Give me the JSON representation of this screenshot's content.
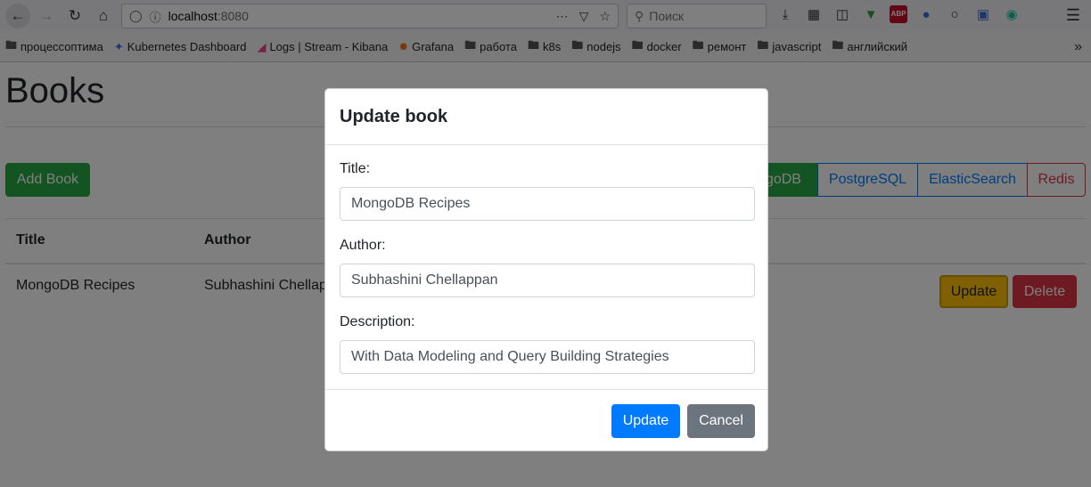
{
  "browser": {
    "url_host": "localhost",
    "url_port": ":8080",
    "search_placeholder": "Поиск",
    "bookmarks": [
      {
        "label": "процессоптима",
        "icon": "folder-icon"
      },
      {
        "label": "Kubernetes Dashboard",
        "icon": "kubernetes-icon"
      },
      {
        "label": "Logs | Stream - Kibana",
        "icon": "kibana-icon"
      },
      {
        "label": "Grafana",
        "icon": "grafana-icon"
      },
      {
        "label": "работа",
        "icon": "folder-icon"
      },
      {
        "label": "k8s",
        "icon": "folder-icon"
      },
      {
        "label": "nodejs",
        "icon": "folder-icon"
      },
      {
        "label": "docker",
        "icon": "folder-icon"
      },
      {
        "label": "ремонт",
        "icon": "folder-icon"
      },
      {
        "label": "javascript",
        "icon": "folder-icon"
      },
      {
        "label": "английский",
        "icon": "folder-icon"
      }
    ],
    "abp_label": "ABP"
  },
  "page": {
    "title": "Books",
    "add_book_label": "Add Book",
    "db_buttons": [
      "ngoDB",
      "PostgreSQL",
      "ElasticSearch",
      "Redis"
    ],
    "table": {
      "headers": [
        "Title",
        "Author"
      ],
      "rows": [
        {
          "title": "MongoDB Recipes",
          "author": "Subhashini Chellap"
        }
      ],
      "update_label": "Update",
      "delete_label": "Delete"
    }
  },
  "modal": {
    "title": "Update book",
    "fields": [
      {
        "label": "Title:",
        "value": "MongoDB Recipes"
      },
      {
        "label": "Author:",
        "value": "Subhashini Chellappan"
      },
      {
        "label": "Description:",
        "value": "With Data Modeling and Query Building Strategies"
      }
    ],
    "update_label": "Update",
    "cancel_label": "Cancel"
  },
  "colors": {
    "success": "#28a745",
    "primary": "#007bff",
    "warning": "#ffc107",
    "danger": "#dc3545",
    "secondary": "#6c757d"
  }
}
